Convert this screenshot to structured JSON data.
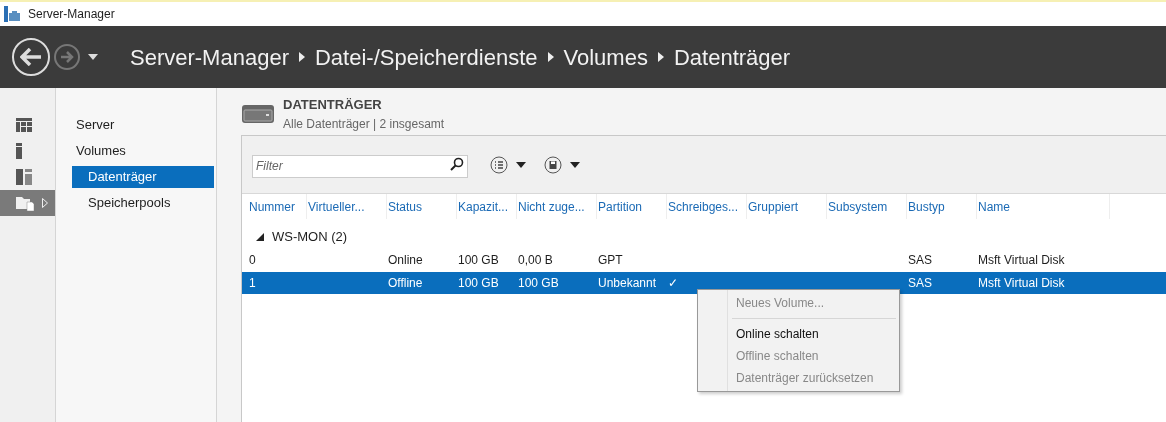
{
  "window": {
    "title": "Server-Manager"
  },
  "breadcrumb": [
    "Server-Manager",
    "Datei-/Speicherdienste",
    "Volumes",
    "Datenträger"
  ],
  "rail": [
    {
      "kind": "dashboard",
      "selected": false
    },
    {
      "kind": "server",
      "selected": false
    },
    {
      "kind": "roles",
      "selected": false
    },
    {
      "kind": "files",
      "selected": true
    }
  ],
  "nav": [
    {
      "label": "Server",
      "selected": false,
      "indent": false
    },
    {
      "label": "Volumes",
      "selected": false,
      "indent": false
    },
    {
      "label": "Datenträger",
      "selected": true,
      "indent": true
    },
    {
      "label": "Speicherpools",
      "selected": false,
      "indent": true
    }
  ],
  "section": {
    "title": "DATENTRÄGER",
    "subtitle": "Alle Datenträger | 2 insgesamt"
  },
  "filter": {
    "placeholder": "Filter"
  },
  "table": {
    "columns": [
      "Nummer",
      "Virtueller...",
      "Status",
      "Kapazit...",
      "Nicht zuge...",
      "Partition",
      "Schreibges...",
      "Gruppiert",
      "Subsystem",
      "Bustyp",
      "Name"
    ],
    "group": {
      "label": "WS-MON (2)",
      "expanded": true
    },
    "rows": [
      {
        "selected": false,
        "cells": [
          "0",
          "",
          "Online",
          "100 GB",
          "0,00 B",
          "GPT",
          "",
          "",
          "",
          "SAS",
          "Msft Virtual Disk"
        ]
      },
      {
        "selected": true,
        "cells": [
          "1",
          "",
          "Offline",
          "100 GB",
          "100 GB",
          "Unbekannt",
          "✓",
          "",
          "",
          "SAS",
          "Msft Virtual Disk"
        ]
      }
    ]
  },
  "context_menu": [
    {
      "kind": "item",
      "label": "Neues Volume...",
      "disabled": true
    },
    {
      "kind": "separator"
    },
    {
      "kind": "item",
      "label": "Online schalten",
      "disabled": false
    },
    {
      "kind": "item",
      "label": "Offline schalten",
      "disabled": true
    },
    {
      "kind": "item",
      "label": "Datenträger zurücksetzen",
      "disabled": true
    }
  ]
}
